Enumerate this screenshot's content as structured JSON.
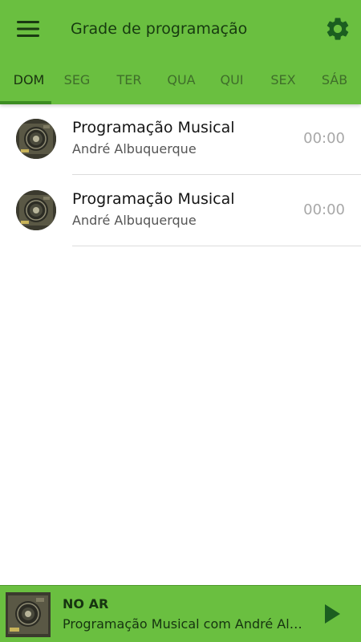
{
  "header": {
    "title": "Grade de programação",
    "menu_icon": "menu-icon",
    "settings_icon": "gear-icon"
  },
  "tabs": [
    {
      "label": "DOM",
      "active": true
    },
    {
      "label": "SEG",
      "active": false
    },
    {
      "label": "TER",
      "active": false
    },
    {
      "label": "QUA",
      "active": false
    },
    {
      "label": "QUI",
      "active": false
    },
    {
      "label": "SEX",
      "active": false
    },
    {
      "label": "SÁB",
      "active": false
    }
  ],
  "schedule": [
    {
      "title": "Programação Musical",
      "host": "André Albuquerque",
      "time": "00:00"
    },
    {
      "title": "Programação Musical",
      "host": "André Albuquerque",
      "time": "00:00"
    }
  ],
  "player": {
    "status": "NO AR",
    "track": "Programação Musical com André Albuquerque",
    "play_icon": "play-icon"
  },
  "colors": {
    "primary": "#6abf40",
    "primary_dark": "#3d8d22",
    "icon_dark": "#1b5e20",
    "time_text": "#a8a8a8"
  }
}
